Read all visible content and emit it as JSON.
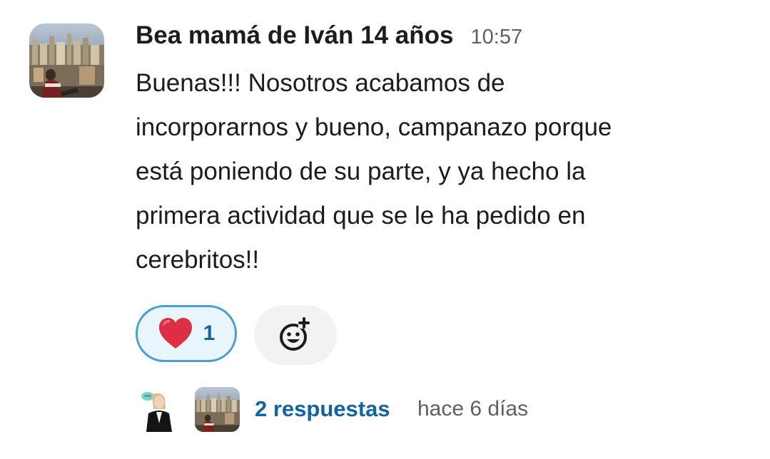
{
  "message": {
    "author": "Bea mamá de Iván 14 años",
    "time": "10:57",
    "lines": [
      "Buenas!!! Nosotros acabamos de",
      "incorporarnos y bueno, campanazo porque",
      "está poniendo de su parte, y ya hecho la",
      "primera actividad que se le ha pedido en",
      "cerebritos!!"
    ]
  },
  "reactions": [
    {
      "emoji": "heart-icon",
      "count": "1"
    }
  ],
  "add_reaction_icon": "add-reaction-icon",
  "thread": {
    "replies_label": "2 respuestas",
    "last_reply": "hace 6 días"
  },
  "colors": {
    "link": "#1264a3",
    "reaction_border": "#4a9fd1",
    "reaction_bg": "#e8f5fa",
    "muted": "#616061",
    "text": "#1d1c1d"
  }
}
